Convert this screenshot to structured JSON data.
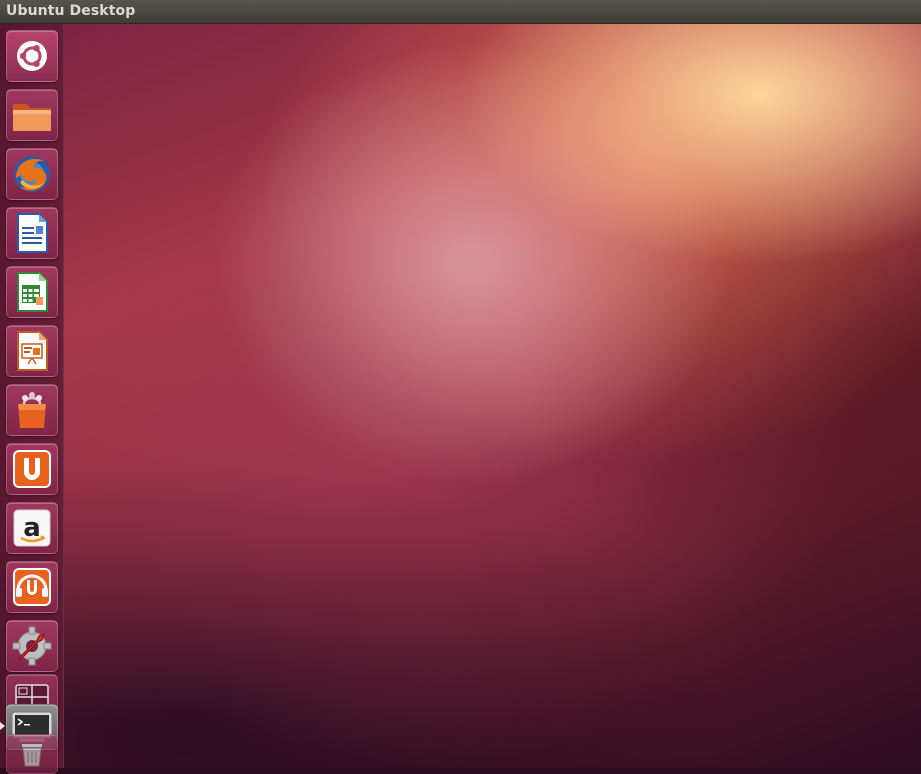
{
  "top_panel": {
    "window_title": "Ubuntu Desktop"
  },
  "launcher": {
    "items": [
      {
        "icon": "dash-home-icon"
      },
      {
        "icon": "files-icon"
      },
      {
        "icon": "firefox-icon"
      },
      {
        "icon": "libreoffice-writer-icon"
      },
      {
        "icon": "libreoffice-calc-icon"
      },
      {
        "icon": "libreoffice-impress-icon"
      },
      {
        "icon": "software-center-icon"
      },
      {
        "icon": "ubuntu-one-icon"
      },
      {
        "icon": "amazon-icon"
      },
      {
        "icon": "ubuntu-one-music-icon"
      },
      {
        "icon": "system-settings-icon"
      },
      {
        "icon": "workspace-switcher-icon"
      },
      {
        "icon": "terminal-icon"
      },
      {
        "icon": "trash-icon"
      }
    ]
  },
  "colors": {
    "panel": "#3c3b37",
    "accent": "#dd4814"
  }
}
